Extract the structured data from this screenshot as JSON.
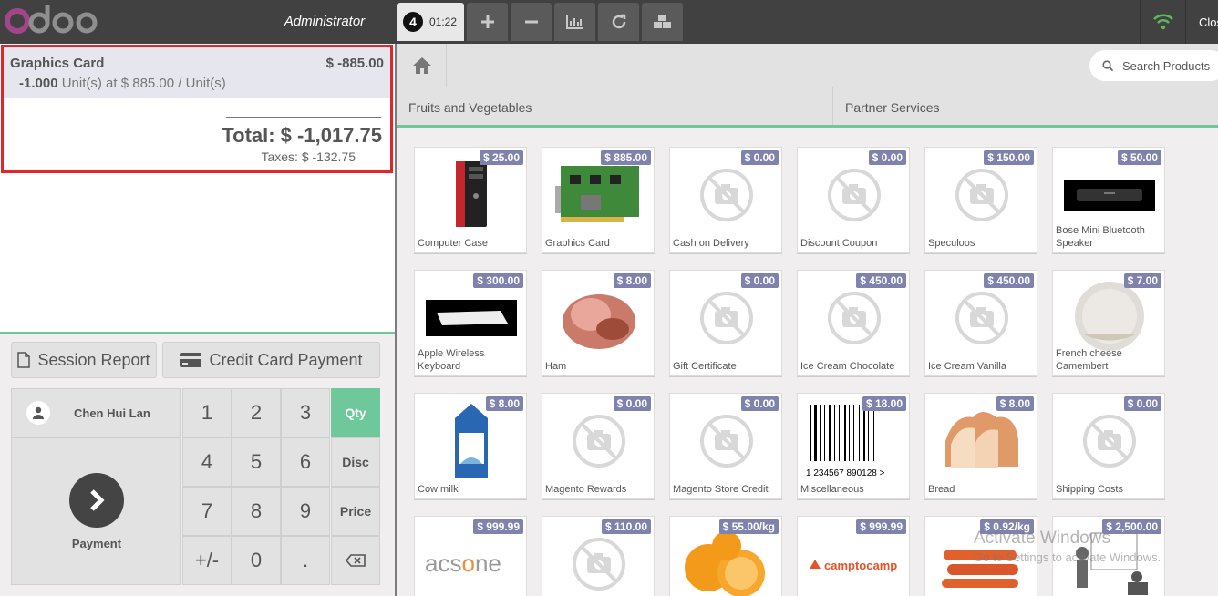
{
  "topbar": {
    "brand": "odoo",
    "user": "Administrator",
    "order_number": "4",
    "order_time": "01:22",
    "close_label": "Close",
    "wifi_color": "#5cb85c",
    "buttons": [
      "plus-icon",
      "minus-icon",
      "chart-icon",
      "refresh-icon",
      "cubes-icon"
    ]
  },
  "order": {
    "line_name": "Graphics Card",
    "line_price": "$ -885.00",
    "line_qty": "-1.000",
    "line_unit_text": "Unit(s) at $ 885.00 / Unit(s)",
    "total": "Total: $ -1,017.75",
    "taxes": "Taxes: $ -132.75",
    "highlight_color": "#e3242b"
  },
  "controls": {
    "session_report": "Session Report",
    "credit_card_payment": "Credit Card Payment",
    "customer": "Chen Hui Lan",
    "payment": "Payment"
  },
  "numpad": {
    "keys": [
      "1",
      "2",
      "3",
      "4",
      "5",
      "6",
      "7",
      "8",
      "9",
      "+/-",
      "0",
      "."
    ],
    "modes": [
      "Qty",
      "Disc",
      "Price"
    ],
    "selected_mode": "Qty",
    "backspace_icon": "backspace-icon",
    "accent": "#6ec89b"
  },
  "search": {
    "placeholder": "Search Products"
  },
  "categories": [
    "Fruits and Vegetables",
    "Partner Services"
  ],
  "products": [
    {
      "name": "Computer Case",
      "price": "$ 25.00",
      "img": "computer-case"
    },
    {
      "name": "Graphics Card",
      "price": "$ 885.00",
      "img": "graphics-card"
    },
    {
      "name": "Cash on Delivery",
      "price": "$ 0.00",
      "img": "no-image"
    },
    {
      "name": "Discount Coupon",
      "price": "$ 0.00",
      "img": "no-image"
    },
    {
      "name": "Speculoos",
      "price": "$ 150.00",
      "img": "no-image"
    },
    {
      "name": "Bose Mini Bluetooth Speaker",
      "price": "$ 50.00",
      "img": "speaker"
    },
    {
      "name": "Apple Wireless Keyboard",
      "price": "$ 300.00",
      "img": "keyboard"
    },
    {
      "name": "Ham",
      "price": "$ 8.00",
      "img": "ham"
    },
    {
      "name": "Gift Certificate",
      "price": "$ 0.00",
      "img": "no-image"
    },
    {
      "name": "Ice Cream Chocolate",
      "price": "$ 450.00",
      "img": "no-image"
    },
    {
      "name": "Ice Cream Vanilla",
      "price": "$ 450.00",
      "img": "no-image"
    },
    {
      "name": "French cheese Camembert",
      "price": "$ 7.00",
      "img": "cheese"
    },
    {
      "name": "Cow milk",
      "price": "$ 8.00",
      "img": "milk"
    },
    {
      "name": "Magento Rewards",
      "price": "$ 0.00",
      "img": "no-image"
    },
    {
      "name": "Magento Store Credit",
      "price": "$ 0.00",
      "img": "no-image"
    },
    {
      "name": "Miscellaneous",
      "price": "$ 18.00",
      "img": "barcode",
      "barcode_text": "1 234567 890128 >"
    },
    {
      "name": "Bread",
      "price": "$ 8.00",
      "img": "bread"
    },
    {
      "name": "Shipping Costs",
      "price": "$ 0.00",
      "img": "no-image"
    },
    {
      "name": "",
      "price": "$ 999.99",
      "img": "acsone",
      "logo_text": "acsone"
    },
    {
      "name": "",
      "price": "$ 110.00",
      "img": "no-image"
    },
    {
      "name": "",
      "price": "$ 55.00/kg",
      "img": "oranges"
    },
    {
      "name": "",
      "price": "$ 999.99",
      "img": "camptocamp",
      "logo_text": "camptocamp"
    },
    {
      "name": "",
      "price": "$ 0.92/kg",
      "img": "carrots"
    },
    {
      "name": "",
      "price": "$ 2,500.00",
      "img": "training"
    }
  ],
  "watermark": {
    "title": "Activate Windows",
    "subtitle": "Go to Settings to activate Windows."
  }
}
